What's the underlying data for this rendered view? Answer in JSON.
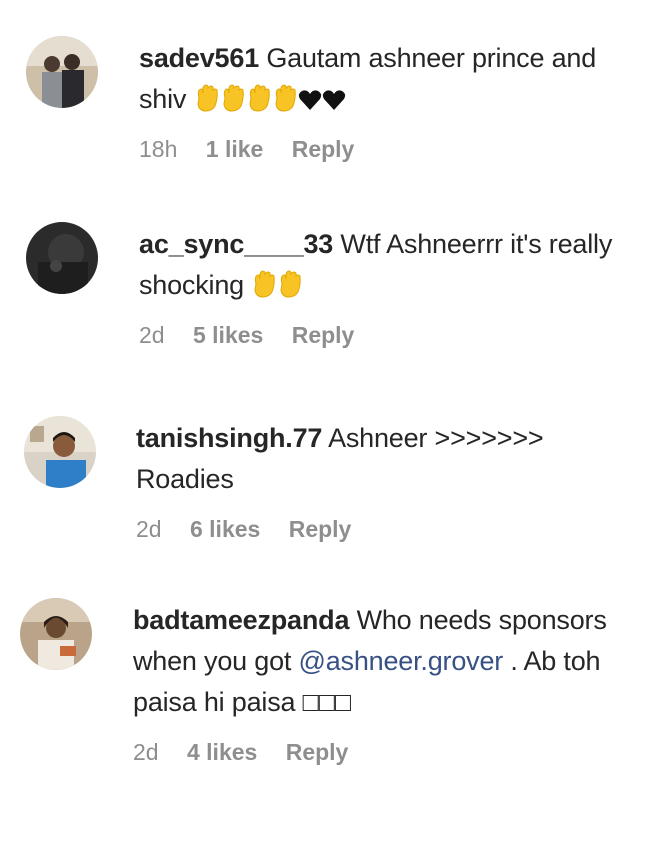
{
  "comments": [
    {
      "username": "sadev561",
      "text_before": "Gautam ashneer prince and shiv",
      "emoji_names": [
        "raised-hand-emoji",
        "raised-hand-emoji",
        "raised-hand-emoji",
        "raised-hand-emoji",
        "black-heart-emoji",
        "black-heart-emoji"
      ],
      "time": "18h",
      "likes": "1 like",
      "reply": "Reply"
    },
    {
      "username": "ac_sync____33",
      "text_before": "Wtf Ashneerrr it's really shocking",
      "emoji_names": [
        "raised-hand-emoji",
        "raised-hand-emoji"
      ],
      "time": "2d",
      "likes": "5 likes",
      "reply": "Reply"
    },
    {
      "username": "tanishsingh.77",
      "text_before": "Ashneer >>>>>>> Roadies",
      "time": "2d",
      "likes": "6 likes",
      "reply": "Reply"
    },
    {
      "username": "badtameezpanda",
      "text_before": "Who needs sponsors when you got",
      "mention": "@ashneer.grover",
      "text_after": ". Ab toh paisa hi paisa",
      "trailing_glyphs": "□□□",
      "time": "2d",
      "likes": "4 likes",
      "reply": "Reply"
    }
  ],
  "colors": {
    "text": "#262626",
    "meta": "#8e8e8e",
    "mention": "#385185",
    "emoji_yellow": "#f7c325"
  }
}
